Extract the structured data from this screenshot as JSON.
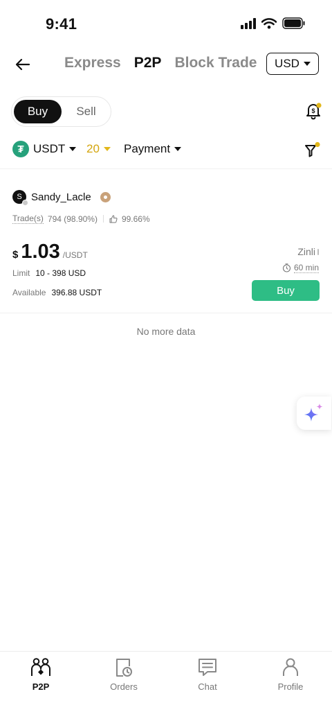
{
  "status_bar": {
    "time": "9:41"
  },
  "top_nav": {
    "tabs": [
      {
        "label": "Express",
        "active": false
      },
      {
        "label": "P2P",
        "active": true
      },
      {
        "label": "Block Trade",
        "active": false
      }
    ],
    "currency": "USD"
  },
  "toggle": {
    "buy": "Buy",
    "sell": "Sell",
    "selected": "Buy"
  },
  "filters": {
    "coin": "USDT",
    "coin_icon": "tether-icon",
    "amount": "20",
    "payment": "Payment"
  },
  "ad": {
    "avatar_letter": "S",
    "merchant": "Sandy_Lacle",
    "trades_label": "Trade(s)",
    "trades_value": "794 (98.90%)",
    "rating": "99.66%",
    "price_symbol": "$",
    "price": "1.03",
    "price_unit": "/USDT",
    "limit_label": "Limit",
    "limit_value": "10 - 398 USD",
    "available_label": "Available",
    "available_value": "396.88 USDT",
    "payment_method": "Zinli",
    "time_limit": "60 min",
    "buy_label": "Buy"
  },
  "no_more": "No more data",
  "bottom_nav": [
    {
      "label": "P2P",
      "icon": "p2p-users-icon",
      "active": true
    },
    {
      "label": "Orders",
      "icon": "orders-icon",
      "active": false
    },
    {
      "label": "Chat",
      "icon": "chat-icon",
      "active": false
    },
    {
      "label": "Profile",
      "icon": "profile-icon",
      "active": false
    }
  ],
  "colors": {
    "accent_green": "#2ebd85",
    "gold": "#e2b71b",
    "tether": "#26a17b"
  }
}
